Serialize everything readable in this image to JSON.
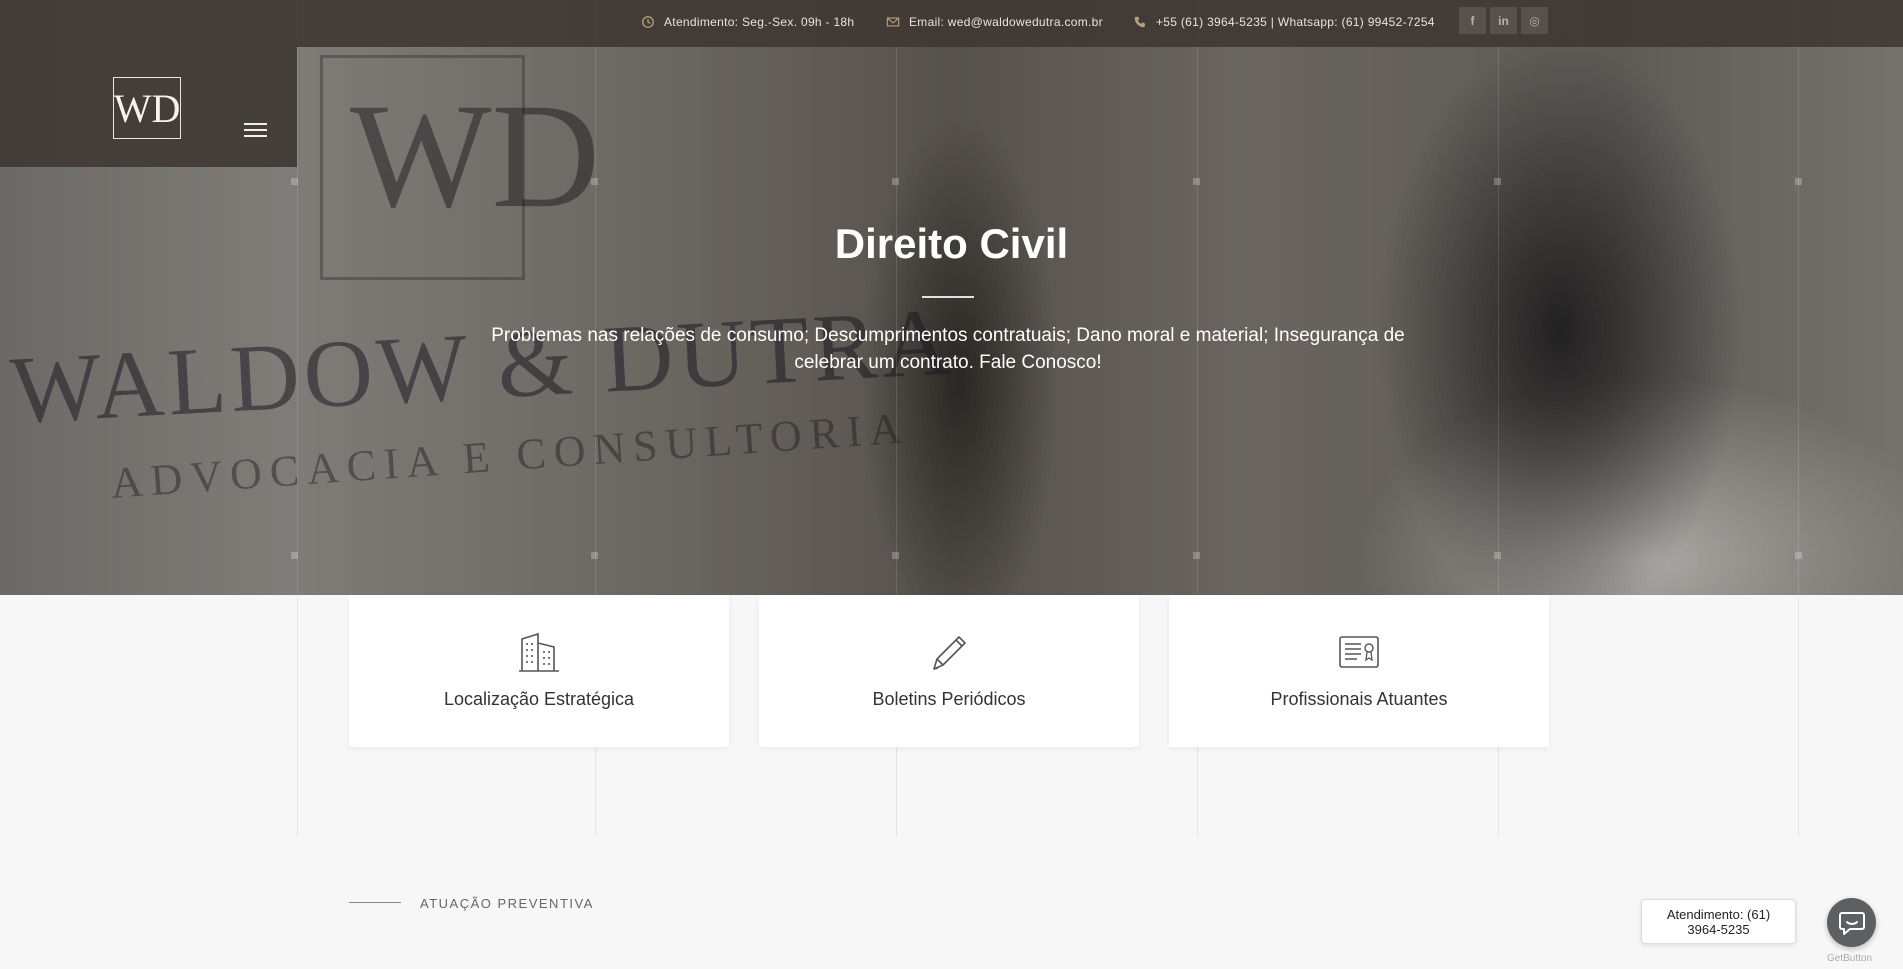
{
  "topbar": {
    "hours": "Atendimento: Seg.-Sex. 09h - 18h",
    "email": "Email: wed@waldowedutra.com.br",
    "phone": "+55 (61) 3964-5235 | Whatsapp: (61) 99452-7254",
    "social": [
      {
        "name": "facebook-icon",
        "glyph": "f"
      },
      {
        "name": "linkedin-icon",
        "glyph": "in"
      },
      {
        "name": "instagram-icon",
        "glyph": "◎"
      }
    ]
  },
  "logo": {
    "monogram": "WD"
  },
  "hero": {
    "title": "Direito Civil",
    "description": "Problemas nas relações de consumo; Descumprimentos contratuais; Dano moral e material; Insegurança de celebrar um contrato. Fale Conosco!",
    "background_watermark": "WALDOW & DUTRA",
    "background_watermark_sub": "ADVOCACIA E CONSULTORIA"
  },
  "features": [
    {
      "label": "Localização Estratégica",
      "icon": "building-icon"
    },
    {
      "label": "Boletins Periódicos",
      "icon": "pencil-icon"
    },
    {
      "label": "Profissionais Atuantes",
      "icon": "certificate-icon"
    }
  ],
  "section": {
    "label": "ATUAÇÃO PREVENTIVA"
  },
  "chat": {
    "bubble_line1": "Atendimento: (61)",
    "bubble_line2": "3964-5235",
    "credit": "GetButton"
  },
  "colors": {
    "topbar_bg": "#3e3732",
    "accent_icon": "#b8a07a",
    "text_dark": "#333333",
    "chat_button": "#5d5f61"
  }
}
